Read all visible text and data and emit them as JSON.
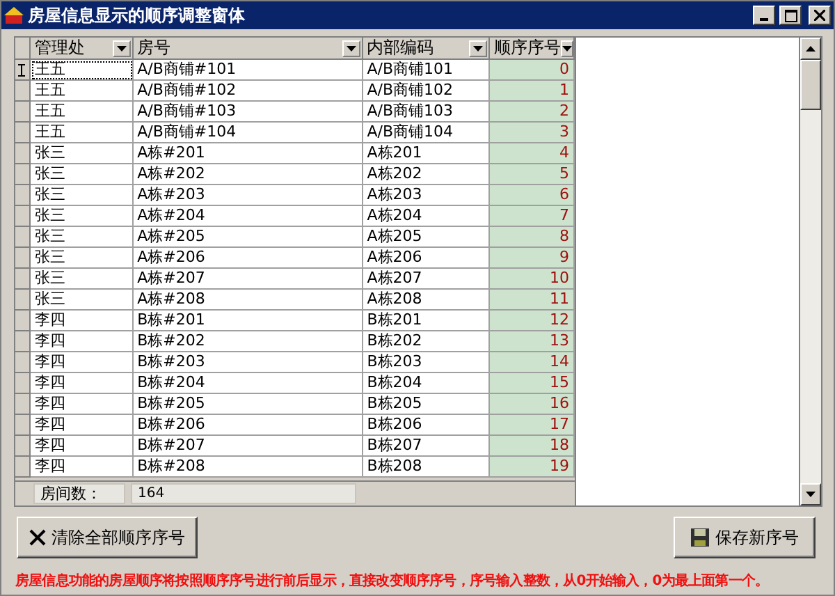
{
  "window": {
    "title": "房屋信息显示的顺序调整窗体"
  },
  "table": {
    "columns": [
      {
        "label": "管理处"
      },
      {
        "label": "房号"
      },
      {
        "label": "内部编码"
      },
      {
        "label": "顺序序号"
      }
    ],
    "rows": [
      {
        "cells": [
          "王五",
          "A/B商铺#101",
          "A/B商铺101",
          "0"
        ],
        "selected": true
      },
      {
        "cells": [
          "王五",
          "A/B商铺#102",
          "A/B商铺102",
          "1"
        ],
        "selected": false
      },
      {
        "cells": [
          "王五",
          "A/B商铺#103",
          "A/B商铺103",
          "2"
        ],
        "selected": false
      },
      {
        "cells": [
          "王五",
          "A/B商铺#104",
          "A/B商铺104",
          "3"
        ],
        "selected": false
      },
      {
        "cells": [
          "张三",
          "A栋#201",
          "A栋201",
          "4"
        ],
        "selected": false
      },
      {
        "cells": [
          "张三",
          "A栋#202",
          "A栋202",
          "5"
        ],
        "selected": false
      },
      {
        "cells": [
          "张三",
          "A栋#203",
          "A栋203",
          "6"
        ],
        "selected": false
      },
      {
        "cells": [
          "张三",
          "A栋#204",
          "A栋204",
          "7"
        ],
        "selected": false
      },
      {
        "cells": [
          "张三",
          "A栋#205",
          "A栋205",
          "8"
        ],
        "selected": false
      },
      {
        "cells": [
          "张三",
          "A栋#206",
          "A栋206",
          "9"
        ],
        "selected": false
      },
      {
        "cells": [
          "张三",
          "A栋#207",
          "A栋207",
          "10"
        ],
        "selected": false
      },
      {
        "cells": [
          "张三",
          "A栋#208",
          "A栋208",
          "11"
        ],
        "selected": false
      },
      {
        "cells": [
          "李四",
          "B栋#201",
          "B栋201",
          "12"
        ],
        "selected": false
      },
      {
        "cells": [
          "李四",
          "B栋#202",
          "B栋202",
          "13"
        ],
        "selected": false
      },
      {
        "cells": [
          "李四",
          "B栋#203",
          "B栋203",
          "14"
        ],
        "selected": false
      },
      {
        "cells": [
          "李四",
          "B栋#204",
          "B栋204",
          "15"
        ],
        "selected": false
      },
      {
        "cells": [
          "李四",
          "B栋#205",
          "B栋205",
          "16"
        ],
        "selected": false
      },
      {
        "cells": [
          "李四",
          "B栋#206",
          "B栋206",
          "17"
        ],
        "selected": false
      },
      {
        "cells": [
          "李四",
          "B栋#207",
          "B栋207",
          "18"
        ],
        "selected": false
      },
      {
        "cells": [
          "李四",
          "B栋#208",
          "B栋208",
          "19"
        ],
        "selected": false
      }
    ],
    "footer": {
      "label": "房间数：",
      "value": "164"
    }
  },
  "buttons": [
    {
      "label": "清除全部顺序序号",
      "kind": "clear"
    },
    {
      "label": "保存新序号",
      "kind": "save"
    }
  ],
  "note": "房屋信息功能的房屋顺序将按照顺序序号进行前后显示，直接改变顺序序号，序号输入整数，从0开始输入，0为最上面第一个。"
}
